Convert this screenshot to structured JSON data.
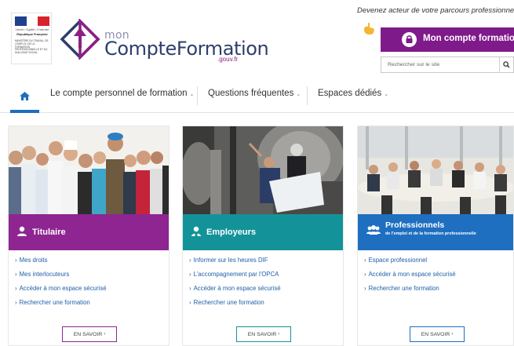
{
  "header": {
    "gov_motto": "Liberté • Égalité • Fraternité",
    "gov_republic": "République Française",
    "gov_ministry": "Ministère du travail, de l'emploi, de la formation professionnelle et du dialogue social",
    "logo_mon": "mon",
    "logo_name": "CompteFormation",
    "logo_gouv": ".gouv.fr",
    "tagline": "Devenez acteur de votre parcours professionnel",
    "account_button": "Mon compte formation",
    "search_placeholder": "Rechercher sur le site",
    "icons": {
      "logo": "compteformation-logo-mark",
      "hand": "pointing-hand-icon",
      "lock": "lock-icon",
      "search": "search-icon"
    },
    "colors": {
      "purple": "#7f1a8b",
      "teal": "#0e8f96",
      "blue": "#1c6fbf",
      "navy": "#2e3e6d"
    }
  },
  "nav": {
    "home_icon": "home-icon",
    "items": [
      {
        "label": "Le compte personnel de formation"
      },
      {
        "label": "Questions fréquentes"
      },
      {
        "label": "Espaces dédiés"
      }
    ]
  },
  "cards": [
    {
      "title": "Titulaire",
      "icon": "person-icon",
      "color": "#8e2591",
      "links": [
        "Mes droits",
        "Mes interlocuteurs",
        "Accéder à mon espace sécurisé",
        "Rechercher une formation"
      ],
      "button": "EN SAVOIR"
    },
    {
      "title": "Employeurs",
      "icon": "employer-icon",
      "color": "#139399",
      "links": [
        "Informer sur les heures DIF",
        "L'accompagnement par l'OPCA",
        "Accéder à mon espace sécurisé",
        "Rechercher une formation"
      ],
      "button": "EN SAVOIR"
    },
    {
      "title": "Professionnels",
      "subtitle": "de l'emploi et de la formation professionnelle",
      "icon": "group-icon",
      "color": "#1e6fc0",
      "links": [
        "Espace professionnel",
        "Accéder à mon espace sécurisé",
        "Rechercher une formation"
      ],
      "button": "EN SAVOIR"
    }
  ]
}
